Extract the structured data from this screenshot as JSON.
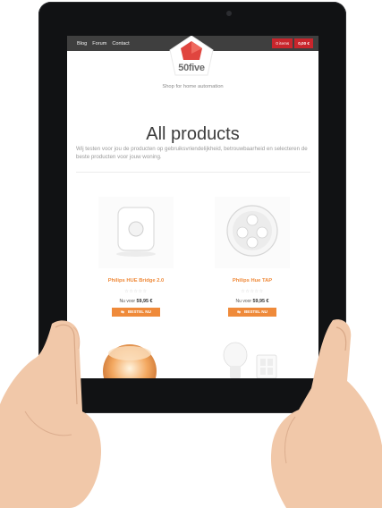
{
  "nav": {
    "items": [
      "Blog",
      "Forum",
      "Contact"
    ]
  },
  "cart": {
    "count_label": "0 items",
    "total": "0,00 €"
  },
  "brand": {
    "logo_text": "50five",
    "tagline": "Shop for home automation"
  },
  "main": {
    "title": "All products",
    "intro": "Wij testen voor jou de producten op gebruiksvriendelijkheid, betrouwbaarheid en selecteren de beste producten voor jouw woning."
  },
  "products": [
    {
      "name": "Philips HUE Bridge 2.0",
      "stars": "☆☆☆☆☆",
      "price_prefix": "Nu voor",
      "price": "59,95 €",
      "button": "BESTEL NU"
    },
    {
      "name": "Philips Hue TAP",
      "stars": "☆☆☆☆☆",
      "price_prefix": "Nu voor",
      "price": "59,95 €",
      "button": "BESTEL NU"
    }
  ],
  "colors": {
    "topbar": "#3f3f3f",
    "cart": "#c9252c",
    "accent": "#ef8a3a",
    "logo": "#e0453f"
  },
  "icons": {
    "cart_button": "cart-icon",
    "logo": "pentagon-logo-icon"
  }
}
